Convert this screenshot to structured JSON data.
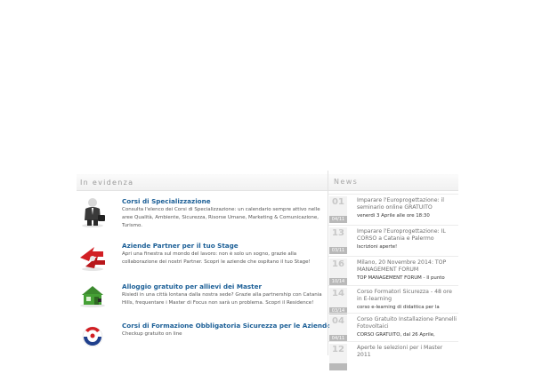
{
  "evidenza": {
    "header": "In evidenza",
    "items": [
      {
        "title": "Corsi di Specializzazione",
        "desc": "Consulta l'elenco dei Corsi di Specializzazione: un calendario sempre attivo nelle aree Qualità, Ambiente, Sicurezza, Risorse Umane, Marketing & Comunicazione, Turismo.",
        "icon": "businessman-icon"
      },
      {
        "title": "Aziende Partner per il tuo Stage",
        "desc": "Apri una finestra sul mondo del lavoro: non è solo un sogno, grazie alla collaborazione dei nostri Partner. Scopri le aziende che ospitano il tuo Stage!",
        "icon": "partner-arrows-icon"
      },
      {
        "title": "Alloggio gratuito per allievi dei Master",
        "desc": "Risiedi in una città lontana dalla nostra sede? Grazie alla partnership con Catania Hills, frequentare i Master di Focus non sarà un problema. Scopri il Residence!",
        "icon": "house-icon"
      },
      {
        "title": "Corsi di Formazione Obbligatoria Sicurezza per le Aziende",
        "desc": "Checkup gratuito on line",
        "icon": "safety-logo-icon"
      }
    ]
  },
  "news": {
    "header": "News",
    "items": [
      {
        "day": "01",
        "month": "04/11",
        "title": "Imparare l'Europrogettazione: il seminario online GRATUITO",
        "sub": "venerdì 3 Aprile alle ore 18:30"
      },
      {
        "day": "13",
        "month": "03/11",
        "title": "Imparare l'Europrogettazione: IL CORSO a Catania e Palermo",
        "sub": "Iscrizioni aperte!"
      },
      {
        "day": "16",
        "month": "10/14",
        "title": "Milano, 20 Novembre 2014: TOP MANAGEMENT FORUM",
        "sub": "TOP MANAGEMENT FORUM - Il punto"
      },
      {
        "day": "14",
        "month": "03/14",
        "title": "Corso Formatori Sicurezza - 48 ore in E-learning",
        "sub": "corso e-learning di didattica per la"
      },
      {
        "day": "04",
        "month": "04/11",
        "title": "Corso Gratuito Installazione Pannelli Fotovoltaici",
        "sub": "CORSO GRATUITO, dal 26 Aprile,"
      },
      {
        "day": "12",
        "month": "",
        "title": "Aperte le selezioni per i Master 2011",
        "sub": ""
      }
    ]
  },
  "colors": {
    "link": "#1a5e96",
    "date_box": "#f2f2f2",
    "date_band": "#b9b9b9"
  }
}
